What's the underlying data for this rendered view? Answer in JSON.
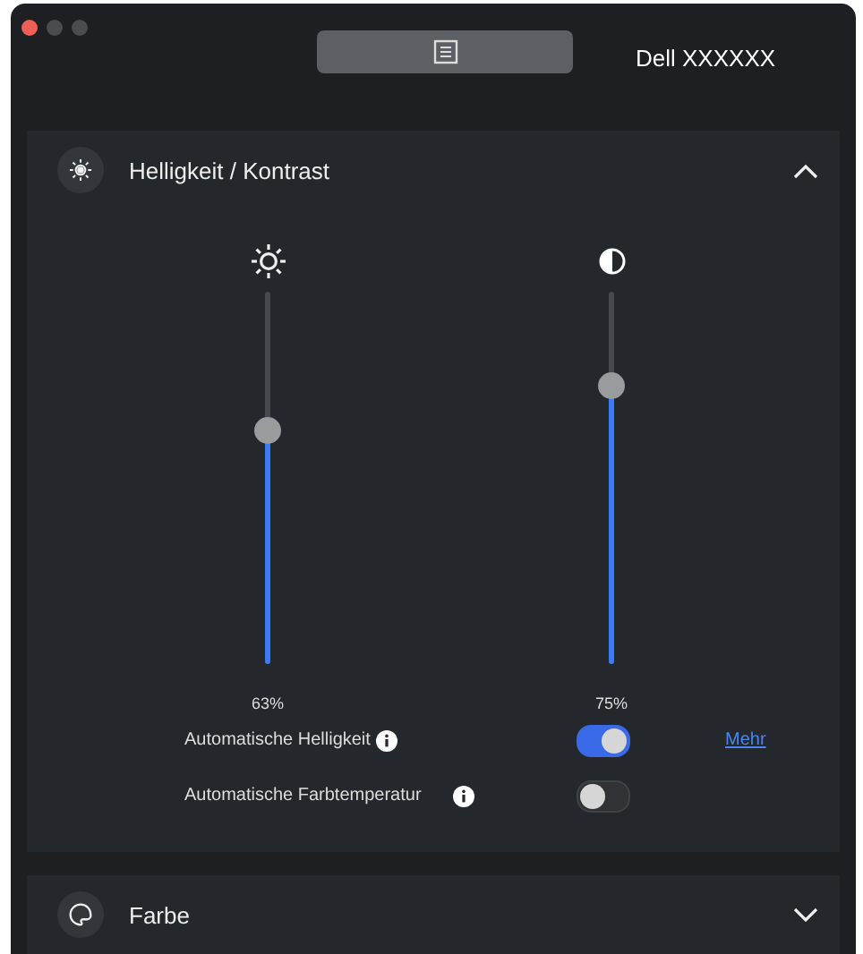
{
  "window": {
    "device_name": "Dell XXXXXX"
  },
  "sections": [
    {
      "title": "Helligkeit / Kontrast",
      "expanded": true,
      "sliders": [
        {
          "kind": "brightness",
          "level": 0.63,
          "reading": "63%"
        },
        {
          "kind": "contrast",
          "level": 0.75,
          "reading": "75%"
        }
      ],
      "toggles": [
        {
          "label": "Automatische Helligkeit",
          "on": true,
          "link": "Mehr"
        },
        {
          "label": "Automatische Farbtemperatur",
          "on": false
        }
      ]
    },
    {
      "title": "Farbe",
      "expanded": false
    }
  ]
}
